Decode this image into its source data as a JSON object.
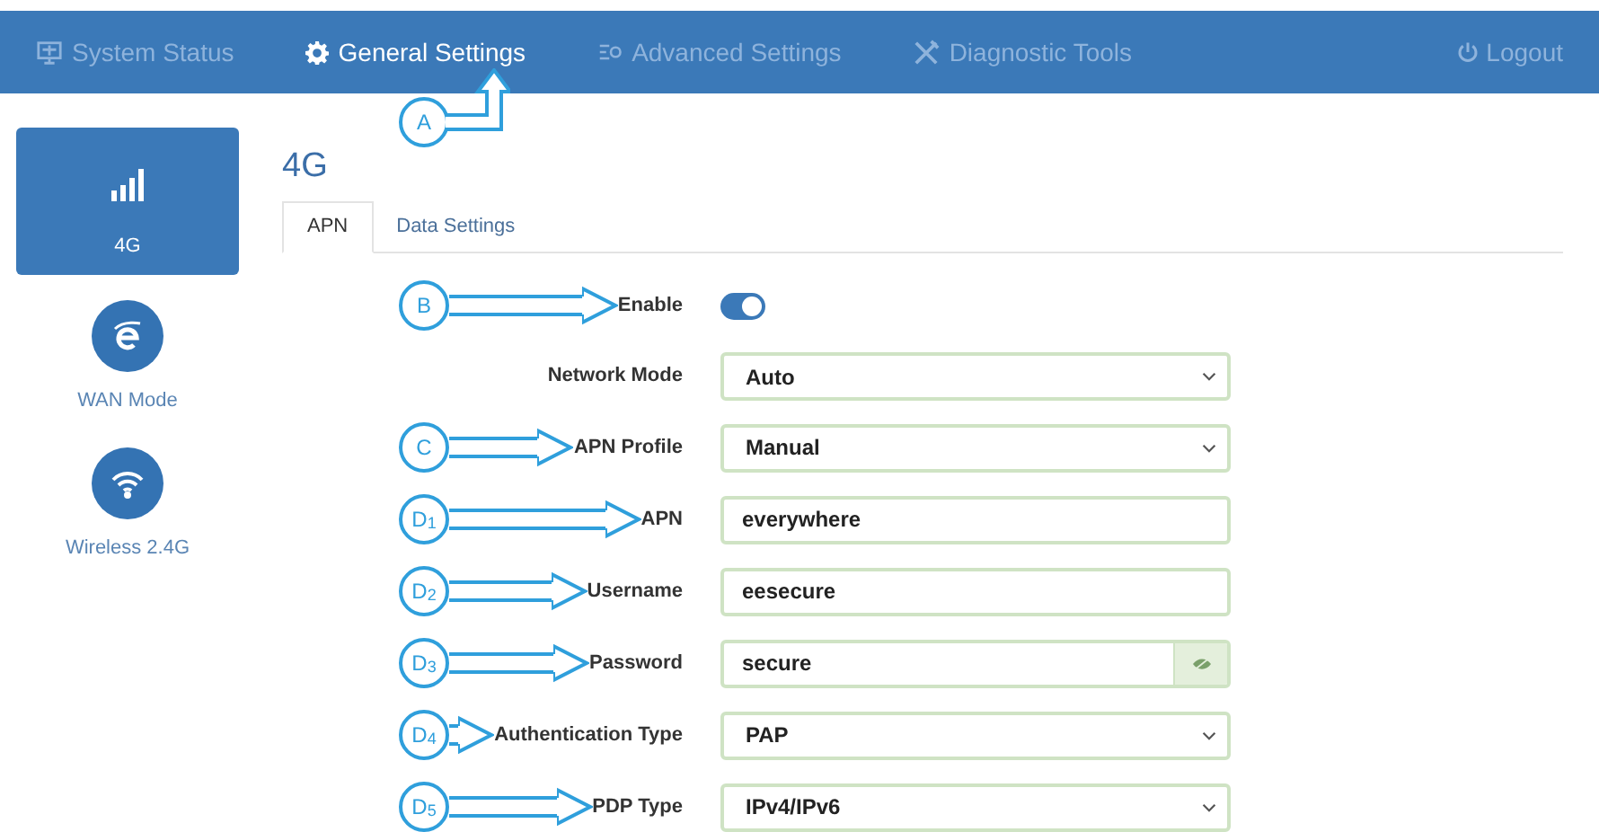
{
  "nav": {
    "items": [
      {
        "label": "System Status",
        "selected": false
      },
      {
        "label": "General Settings",
        "selected": true
      },
      {
        "label": "Advanced Settings",
        "selected": false
      },
      {
        "label": "Diagnostic Tools",
        "selected": false
      }
    ],
    "logout": "Logout"
  },
  "sidebar": {
    "items": [
      {
        "label": "4G",
        "selected": true
      },
      {
        "label": "WAN Mode",
        "selected": false
      },
      {
        "label": "Wireless 2.4G",
        "selected": false
      }
    ]
  },
  "page_title": "4G",
  "tabs": [
    {
      "label": "APN",
      "selected": true
    },
    {
      "label": "Data Settings",
      "selected": false
    }
  ],
  "nav_callout": "A",
  "form": [
    {
      "kind": "toggle",
      "label": "Enable",
      "on": true,
      "callout": "B"
    },
    {
      "kind": "select",
      "label": "Network Mode",
      "value": "Auto"
    },
    {
      "kind": "select",
      "label": "APN Profile",
      "value": "Manual",
      "callout": "C"
    },
    {
      "kind": "text",
      "label": "APN",
      "value": "everywhere",
      "callout": "D$_{1}$"
    },
    {
      "kind": "text",
      "label": "Username",
      "value": "eesecure",
      "callout": "D$_{2}$"
    },
    {
      "kind": "password",
      "label": "Password",
      "value": "secure",
      "callout": "D$_{3}$"
    },
    {
      "kind": "select",
      "label": "Authentication Type",
      "value": "PAP",
      "callout": "D$_{4}$"
    },
    {
      "kind": "select",
      "label": "PDP Type",
      "value": "IPv4/IPv6",
      "callout": "D$_{5}$"
    }
  ]
}
